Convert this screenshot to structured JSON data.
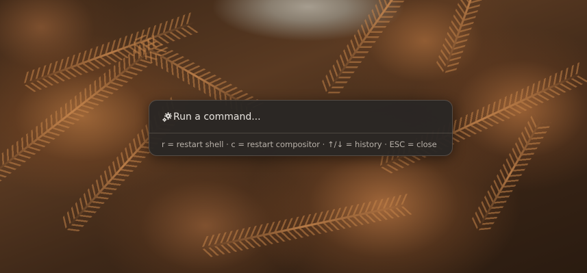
{
  "launcher": {
    "icon": "gear-icon",
    "placeholder": "Run a command...",
    "hint": "r = restart shell · c = restart compositor · ↑/↓ = history · ESC = close"
  },
  "colors": {
    "panel_background": "#2a2624",
    "text_primary": "#e8e4df",
    "text_secondary": "#b9b2aa"
  }
}
